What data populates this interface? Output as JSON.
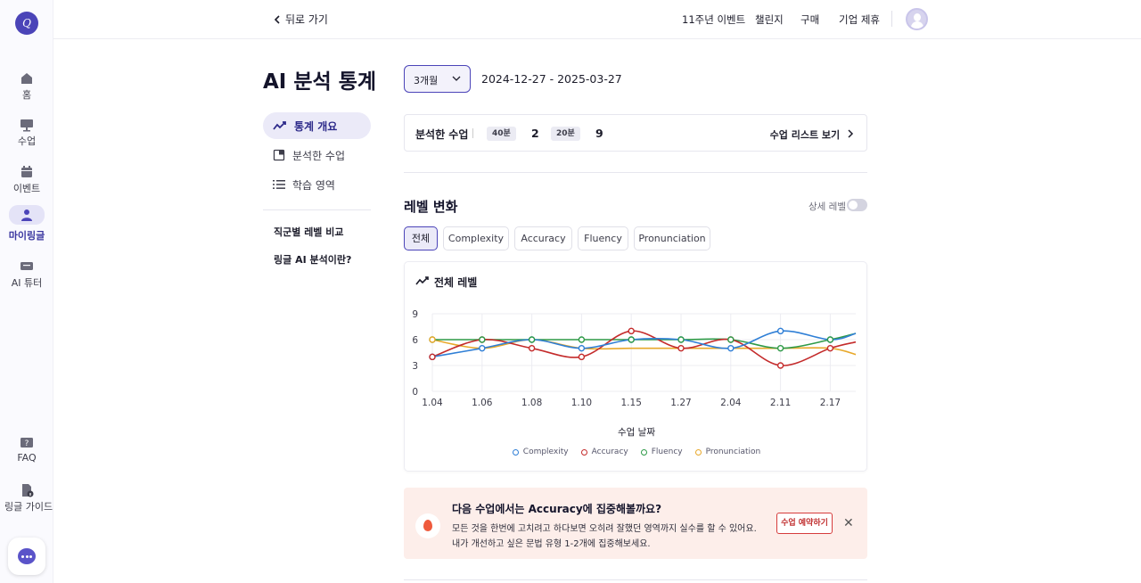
{
  "rail": {
    "logo_text": "Q",
    "items": [
      {
        "label": "홈",
        "icon": "home-icon"
      },
      {
        "label": "수업",
        "icon": "monitor-icon"
      },
      {
        "label": "이벤트",
        "icon": "calendar-icon"
      },
      {
        "label": "마이링글",
        "icon": "person-icon"
      },
      {
        "label": "AI 튜터",
        "icon": "chat-box-icon"
      },
      {
        "label": "FAQ",
        "icon": "question-icon"
      },
      {
        "label": "링글 가이드",
        "icon": "guide-doc-icon"
      }
    ],
    "active_index": 3
  },
  "topbar": {
    "back_label": "뒤로 가기",
    "nav": [
      "11주년 이벤트",
      "챌린지",
      "구매",
      "기업 제휴"
    ]
  },
  "page": {
    "title": "AI 분석 통계",
    "side_menu": [
      "통계 개요",
      "분석한 수업",
      "학습 영역"
    ],
    "side_links": [
      "직군별 레벨 비교",
      "링글 AI 분석이란?"
    ]
  },
  "filter": {
    "period": "3개월",
    "date_range": "2024-12-27 - 2025-03-27"
  },
  "summary": {
    "title": "분석한 수업",
    "chip1": "40분",
    "count1": "2",
    "chip2": "20분",
    "count2": "9",
    "link": "수업 리스트 보기"
  },
  "level": {
    "title": "레벨 변화",
    "detail_toggle_label": "상세 레벨",
    "tabs": [
      "전체",
      "Complexity",
      "Accuracy",
      "Fluency",
      "Pronunciation"
    ],
    "active_tab": 0
  },
  "chart_data": {
    "type": "line",
    "title": "전체 레벨",
    "xlabel": "수업 날짜",
    "ylabel": "",
    "categories": [
      "1.04",
      "1.06",
      "1.08",
      "1.10",
      "1.15",
      "1.27",
      "2.04",
      "2.11",
      "2.17"
    ],
    "ylim": [
      0,
      9
    ],
    "yticks": [
      0,
      3,
      6,
      9
    ],
    "grid": true,
    "legend": "bottom",
    "series": [
      {
        "name": "Complexity",
        "color": "#2f7fd6",
        "values": [
          4,
          5,
          6,
          5,
          6,
          6,
          5,
          7,
          6
        ]
      },
      {
        "name": "Accuracy",
        "color": "#c42b2b",
        "values": [
          4,
          6,
          5,
          4,
          7,
          5,
          6,
          3,
          5
        ]
      },
      {
        "name": "Fluency",
        "color": "#2e9a47",
        "values": [
          6,
          6,
          6,
          6,
          6,
          6,
          6,
          5,
          6
        ]
      },
      {
        "name": "Pronunciation",
        "color": "#e8a82a",
        "values": [
          6,
          5,
          6,
          5,
          5,
          5,
          5,
          5,
          5
        ]
      }
    ]
  },
  "banner": {
    "title": "다음 수업에서는 Accuracy에 집중해볼까요?",
    "line1": "모든 것을 한번에 고치려고 하다보면 오히려 잘했던 영역까지 실수를 할 수 있어요.",
    "line2": "내가 개선하고 싶은 문법 유형 1-2개에 집중해보세요.",
    "button": "수업 예약하기",
    "close": "✕"
  }
}
